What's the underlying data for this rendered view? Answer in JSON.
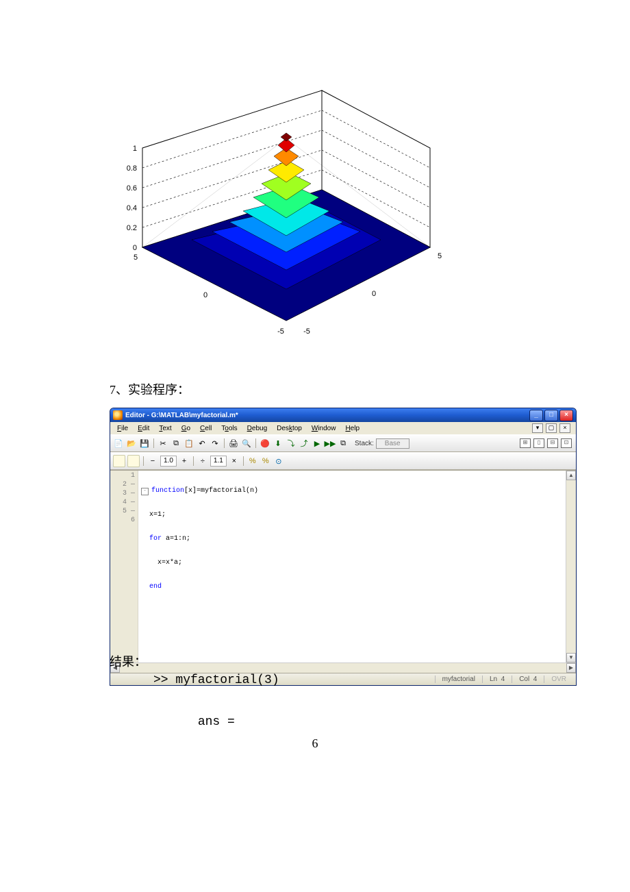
{
  "chart_data": {
    "type": "surface",
    "title": "",
    "xlabel": "",
    "ylabel": "",
    "zlabel": "",
    "x_range": [
      -5,
      5
    ],
    "y_range": [
      -5,
      5
    ],
    "z_range": [
      0,
      1
    ],
    "x_ticks": [
      -5,
      0,
      5
    ],
    "y_ticks": [
      -5,
      0,
      5
    ],
    "z_ticks": [
      0,
      0.2,
      0.4,
      0.6,
      0.8,
      1
    ],
    "view_azimuth_deg": -37.5,
    "view_elevation_deg": 30,
    "colormap": "jet",
    "surface_description": "Gaussian bell surface exp(-(x^2+y^2)/8) over [-5,5]×[-5,5], peak ≈ 1 at (0,0), approaching 0 at edges"
  },
  "doc": {
    "section_heading": "7、实验程序：",
    "result_label": "结果：",
    "output_line1": ">> myfactorial(3)",
    "output_line2": "ans =",
    "page_number": "6"
  },
  "plot": {
    "z": {
      "t0": "0",
      "t1": "0.2",
      "t2": "0.4",
      "t3": "0.6",
      "t4": "0.8",
      "t5": "1"
    },
    "xy": {
      "neg5": "-5",
      "zero": "0",
      "pos5": "5"
    }
  },
  "editor": {
    "title": "Editor - G:\\MATLAB\\myfactorial.m*",
    "menu": {
      "file": "File",
      "edit": "Edit",
      "text": "Text",
      "go": "Go",
      "cell": "Cell",
      "tools": "Tools",
      "debug": "Debug",
      "desktop": "Desktop",
      "window": "Window",
      "help": "Help"
    },
    "window_buttons": {
      "min": "_",
      "max": "□",
      "close": "×"
    },
    "menubar_right": {
      "undock": "▾",
      "popout": "▢",
      "x": "×"
    },
    "toolbar": {
      "newfile": "📄",
      "open": "📂",
      "save": "💾",
      "cut": "✂",
      "copy": "⧉",
      "paste": "📋",
      "undo": "↶",
      "redo": "↷",
      "print": "🖨",
      "find": "🔍",
      "breakpoint": "🔴",
      "step": "⬇",
      "stepin": "⤵",
      "stepout": "⤴",
      "run": "▶",
      "runcell": "▶▶",
      "stack": "⧉",
      "stack_label": "Stack:",
      "stack_value": "Base",
      "val10": "1.0",
      "plus": "+",
      "div": "÷",
      "val11": "1.1",
      "times": "×",
      "eval1": "%",
      "eval2": "%",
      "eval3": "⊙",
      "layout_a": "⊞",
      "layout_b": "▯",
      "layout_c": "⊟",
      "layout_d": "⊡"
    },
    "gutter": {
      "l1": "1",
      "l2": "2",
      "l3": "3",
      "l4": "4",
      "l5": "5",
      "l6": "6",
      "dash": "—"
    },
    "code": {
      "fold": "-",
      "kw_function": "function",
      "l1_rest": "[x]=myfactorial(n)",
      "l2": "x=1;",
      "kw_for": "for",
      "l3_rest": " a=1:n;",
      "l4": "x=x*a;",
      "kw_end": "end"
    },
    "scroll": {
      "up": "▲",
      "down": "▼",
      "left": "◀",
      "right": "▶"
    },
    "status": {
      "fname": "myfactorial",
      "ln_label": "Ln",
      "ln_val": "4",
      "col_label": "Col",
      "col_val": "4",
      "ovr": "OVR"
    }
  }
}
